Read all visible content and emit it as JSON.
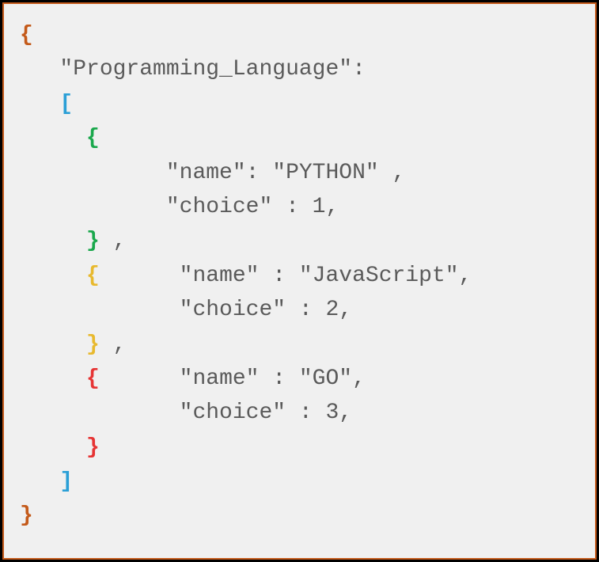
{
  "code": {
    "outer_open": "{",
    "key_label": "\"Programming_Language\":",
    "bracket_open": "[",
    "obj1_open": "{",
    "obj1_line1": "\"name\": \"PYTHON\" ,",
    "obj1_line2": "\"choice\" : 1,",
    "obj1_close": "}",
    "obj1_after": " ,",
    "obj2_open": "{",
    "obj2_line1": "\"name\" : \"JavaScript\",",
    "obj2_line2": " \"choice\" : 2,",
    "obj2_close": "}",
    "obj2_after": " ,",
    "obj3_open": "{",
    "obj3_line1": "\"name\" : \"GO\",",
    "obj3_line2": " \"choice\" : 3,",
    "obj3_close": "}",
    "bracket_close": "]",
    "outer_close": "}"
  }
}
